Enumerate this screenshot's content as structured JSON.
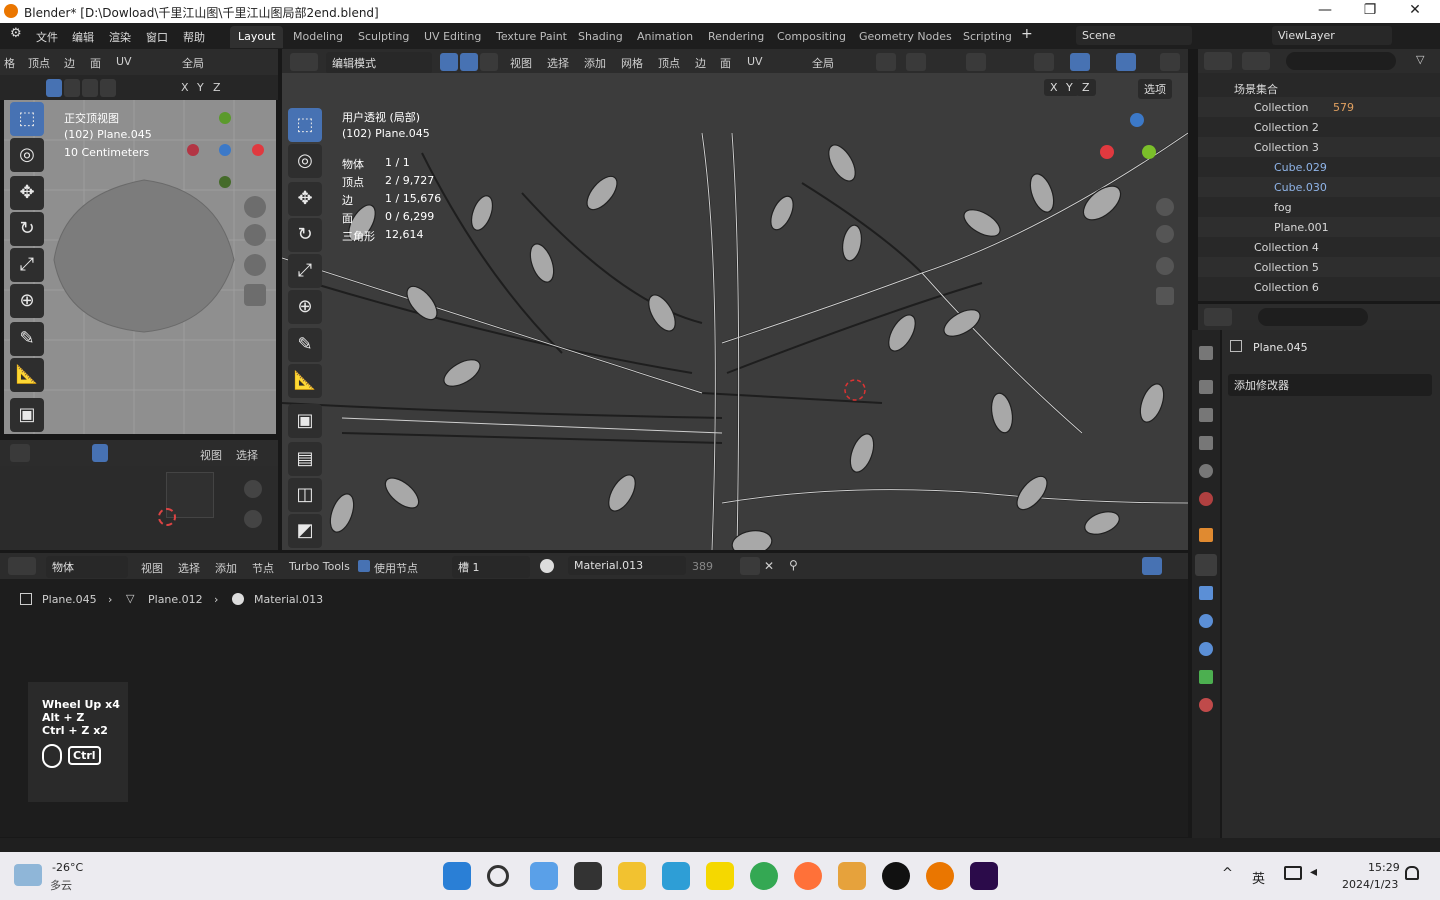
{
  "window": {
    "title": "Blender* [D:\\Dowload\\千里江山图\\千里江山图局部2end.blend]",
    "minimize": "—",
    "maximize": "❐",
    "close": "✕"
  },
  "menu": [
    "文件",
    "编辑",
    "渲染",
    "窗口",
    "帮助"
  ],
  "workspaces": [
    "Layout",
    "Modeling",
    "Sculpting",
    "UV Editing",
    "Texture Paint",
    "Shading",
    "Animation",
    "Rendering",
    "Compositing",
    "Geometry Nodes",
    "Scripting"
  ],
  "scene": "Scene",
  "view_layer": "ViewLayer",
  "left_view_header": {
    "items": [
      "格",
      "顶点",
      "边",
      "面",
      "UV"
    ],
    "transform": "全局"
  },
  "left_view_overlay": {
    "view": "正交顶视图",
    "object": "(102) Plane.045",
    "scale": "10 Centimeters"
  },
  "uv_editor_header": {
    "view": "视图",
    "select": "选择"
  },
  "axes": {
    "x": "X",
    "y": "Y",
    "z": "Z"
  },
  "main_header": {
    "mode": "编辑模式",
    "items": [
      "视图",
      "选择",
      "添加",
      "网格",
      "顶点",
      "边",
      "面",
      "UV"
    ],
    "transform": "全局",
    "options": "选项"
  },
  "viewport_info": {
    "view": "用户透视 (局部)",
    "object": "(102) Plane.045",
    "stats": [
      {
        "label": "物体",
        "value": "1 / 1"
      },
      {
        "label": "顶点",
        "value": "2 / 9,727"
      },
      {
        "label": "边",
        "value": "1 / 15,676"
      },
      {
        "label": "面",
        "value": "0 / 6,299"
      },
      {
        "label": "三角形",
        "value": "12,614"
      }
    ]
  },
  "outliner": {
    "root": "场景集合",
    "rows": [
      {
        "name": "Collection",
        "badge": "579"
      },
      {
        "name": "Collection 2"
      },
      {
        "name": "Collection 3"
      },
      {
        "name": "Cube.029"
      },
      {
        "name": "Cube.030"
      },
      {
        "name": "fog"
      },
      {
        "name": "Plane.001"
      },
      {
        "name": "Collection 4"
      },
      {
        "name": "Collection 5"
      },
      {
        "name": "Collection 6"
      }
    ]
  },
  "properties": {
    "object": "Plane.045",
    "add_modifier": "添加修改器"
  },
  "node_header": {
    "mode": "物体",
    "items": [
      "视图",
      "选择",
      "添加",
      "节点"
    ],
    "turbo": "Turbo Tools",
    "use_nodes": "使用节点",
    "slot": "槽 1",
    "material": "Material.013",
    "users": "389"
  },
  "breadcrumb": [
    "Plane.045",
    "Plane.012",
    "Material.013"
  ],
  "keystrokes": {
    "lines": [
      "Wheel Up x4",
      "Alt + Z",
      "Ctrl + Z x2"
    ],
    "key": "Ctrl"
  },
  "taskbar": {
    "weather_temp": "-26°C",
    "weather_desc": "多云",
    "ime": "英",
    "time": "15:29",
    "date": "2024/1/23"
  },
  "colors": {
    "accent": "#4772b3",
    "blender_orange": "#ea7600",
    "selection": "#ffaf29"
  }
}
